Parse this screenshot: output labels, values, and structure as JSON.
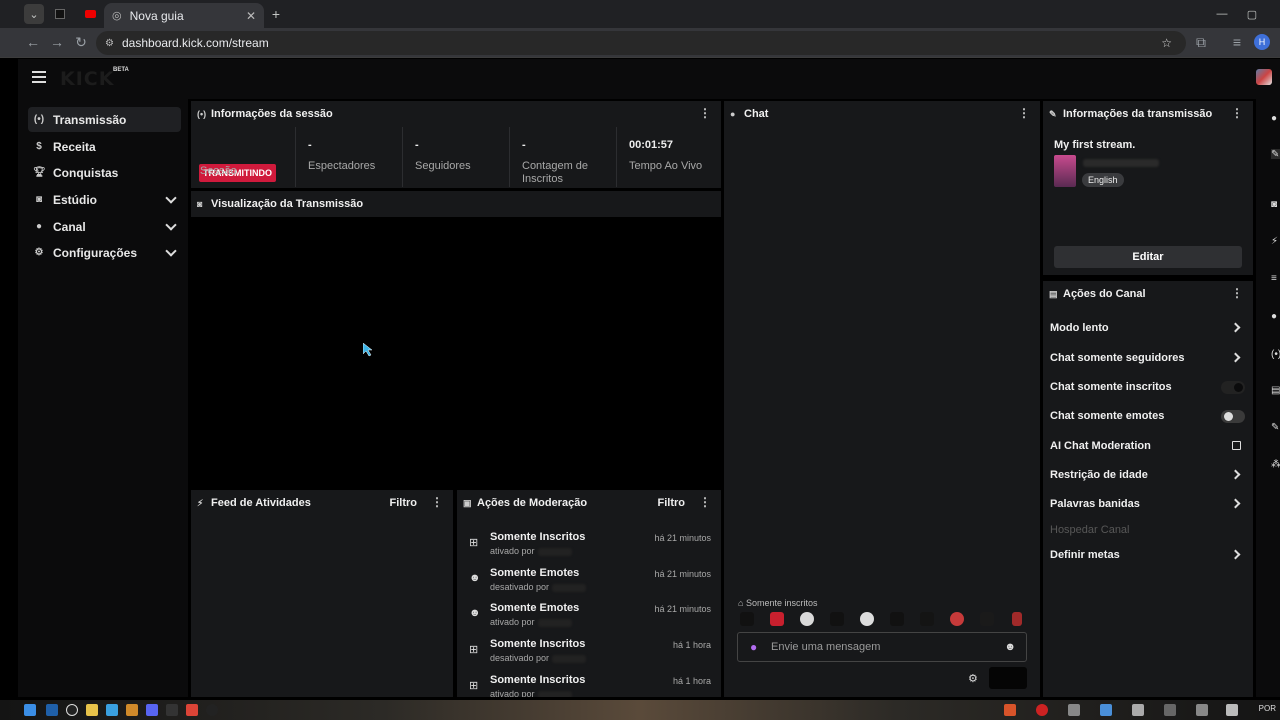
{
  "browser": {
    "tab_title": "Nova guia",
    "url": "dashboard.kick.com/stream",
    "profile_initial": "H"
  },
  "app": {
    "logo_text": "KICK",
    "beta_label": "BETA"
  },
  "sidebar": {
    "items": [
      {
        "label": "Transmissão",
        "icon": "broadcast-icon",
        "active": true
      },
      {
        "label": "Receita",
        "icon": "dollar-icon"
      },
      {
        "label": "Conquistas",
        "icon": "trophy-icon"
      },
      {
        "label": "Estúdio",
        "icon": "studio-icon",
        "expandable": true
      },
      {
        "label": "Canal",
        "icon": "user-icon",
        "expandable": true
      },
      {
        "label": "Configurações",
        "icon": "gear-icon",
        "expandable": true
      }
    ]
  },
  "session": {
    "title": "Informações da sessão",
    "live_badge": "TRANSMITINDO",
    "session_label": "Sessão",
    "stats": [
      {
        "value": "-",
        "label": "Espectadores"
      },
      {
        "value": "-",
        "label": "Seguidores"
      },
      {
        "value": "-",
        "label": "Contagem de Inscritos"
      },
      {
        "value": "00:01:57",
        "label": "Tempo Ao Vivo"
      }
    ]
  },
  "preview": {
    "title": "Visualização da Transmissão"
  },
  "activity": {
    "title": "Feed de Atividades",
    "filter": "Filtro"
  },
  "moderation": {
    "title": "Ações de Moderação",
    "filter": "Filtro",
    "items": [
      {
        "title": "Somente Inscritos",
        "action": "ativado por",
        "time": "há 21 minutos",
        "icon": "gift-icon"
      },
      {
        "title": "Somente Emotes",
        "action": "desativado por",
        "time": "há 21 minutos",
        "icon": "smiley-icon"
      },
      {
        "title": "Somente Emotes",
        "action": "ativado por",
        "time": "há 21 minutos",
        "icon": "smiley-icon"
      },
      {
        "title": "Somente Inscritos",
        "action": "desativado por",
        "time": "há 1 hora",
        "icon": "gift-icon"
      },
      {
        "title": "Somente Inscritos",
        "action": "ativado por",
        "time": "há 1 hora",
        "icon": "gift-icon"
      }
    ]
  },
  "chat": {
    "title": "Chat",
    "mode_label": "Somente inscritos",
    "input_placeholder": "Envie uma mensagem"
  },
  "stream_info": {
    "title": "Informações da transmissão",
    "stream_title": "My first stream.",
    "language": "English",
    "edit_button": "Editar"
  },
  "channel_actions": {
    "title": "Ações do Canal",
    "items": [
      {
        "label": "Modo lento",
        "type": "chevron"
      },
      {
        "label": "Chat somente seguidores",
        "type": "chevron"
      },
      {
        "label": "Chat somente inscritos",
        "type": "toggle",
        "on": true
      },
      {
        "label": "Chat somente emotes",
        "type": "toggle",
        "on": false
      },
      {
        "label": "AI Chat Moderation",
        "type": "external"
      },
      {
        "label": "Restrição de idade",
        "type": "chevron"
      },
      {
        "label": "Palavras banidas",
        "type": "chevron"
      },
      {
        "label": "Hospedar Canal",
        "type": "disabled"
      },
      {
        "label": "Definir metas",
        "type": "chevron"
      }
    ]
  },
  "taskbar": {
    "language": "POR"
  },
  "colors": {
    "live_badge": "#d01a3c",
    "panel_bg": "#17181a",
    "app_bg": "#0b0b0c"
  }
}
